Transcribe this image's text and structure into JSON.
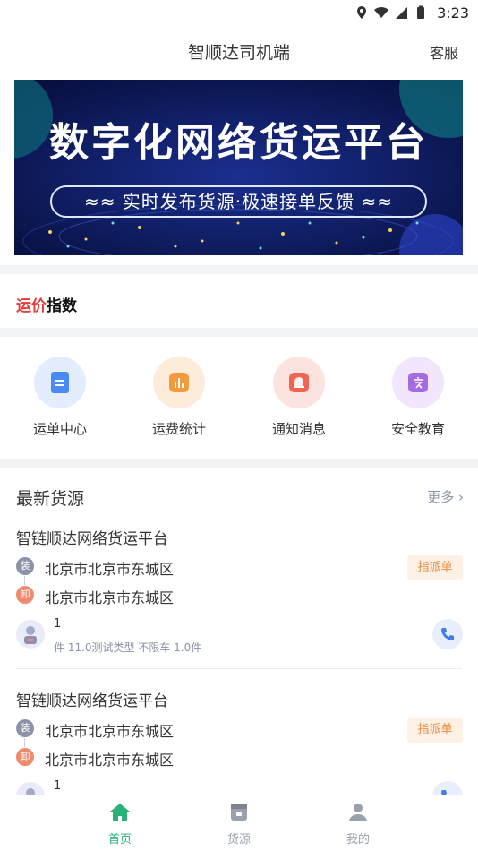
{
  "status_bar": {
    "time": "3:23"
  },
  "header": {
    "title": "智顺达司机端",
    "service": "客服"
  },
  "banner": {
    "headline": "数字化网络货运平台",
    "subline": "≈≈  实时发布货源·极速接单反馈  ≈≈"
  },
  "freight_index": {
    "accent": "运价",
    "label": "指数"
  },
  "menu": [
    {
      "label": "运单中心",
      "icon": "waybill-icon",
      "color": "#4a8af4"
    },
    {
      "label": "运费统计",
      "icon": "chart-icon",
      "color": "#f59a3c"
    },
    {
      "label": "通知消息",
      "icon": "bell-icon",
      "color": "#f06452"
    },
    {
      "label": "安全教育",
      "icon": "safety-icon",
      "color": "#a66be0"
    }
  ],
  "latest": {
    "title": "最新货源",
    "more": "更多",
    "cards": [
      {
        "company": "智链顺达网络货运平台",
        "load_tag": "装",
        "unload_tag": "卸",
        "from": "北京市北京市东城区",
        "to": "北京市北京市东城区",
        "badge": "指派单",
        "count": "1",
        "desc": "件 11.0测试类型 不限车 1.0件"
      },
      {
        "company": "智链顺达网络货运平台",
        "load_tag": "装",
        "unload_tag": "卸",
        "from": "北京市北京市东城区",
        "to": "北京市北京市东城区",
        "badge": "指派单",
        "count": "1",
        "desc": ""
      }
    ]
  },
  "nav": [
    {
      "label": "首页",
      "icon": "home-icon",
      "active": true
    },
    {
      "label": "货源",
      "icon": "cargo-icon",
      "active": false
    },
    {
      "label": "我的",
      "icon": "profile-icon",
      "active": false
    }
  ],
  "colors": {
    "accent_green": "#2bb07a",
    "nav_inactive": "#9aa0ad",
    "badge_orange": "#f08a3a",
    "banner_bg": "#0c1a5c"
  }
}
